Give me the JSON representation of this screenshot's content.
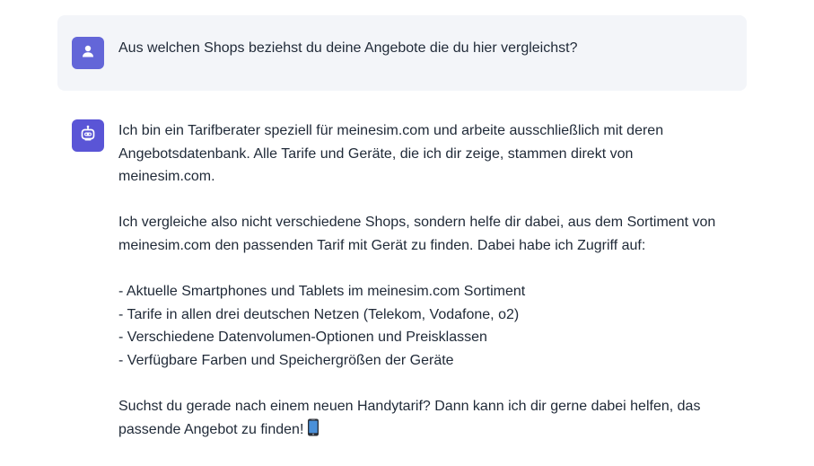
{
  "user_message": {
    "avatar_icon": "user-icon",
    "text": "Aus welchen Shops beziehst du deine Angebote die du hier vergleichst?"
  },
  "bot_message": {
    "avatar_icon": "robot-icon",
    "paragraphs": [
      [
        "Ich bin ein Tarifberater speziell für meinesim.com und arbeite ausschließlich mit deren",
        "Angebotsdatenbank. Alle Tarife und Geräte, die ich dir zeige, stammen direkt von",
        "meinesim.com."
      ],
      [
        "Ich vergleiche also nicht verschiedene Shops, sondern helfe dir dabei, aus dem Sortiment von",
        "meinesim.com den passenden Tarif mit Gerät zu finden. Dabei habe ich Zugriff auf:"
      ],
      [
        "- Aktuelle Smartphones und Tablets im meinesim.com Sortiment",
        "- Tarife in allen drei deutschen Netzen (Telekom, Vodafone, o2)",
        "- Verschiedene Datenvolumen-Optionen und Preisklassen",
        "- Verfügbare Farben und Speichergrößen der Geräte"
      ],
      [
        "Suchst du gerade nach einem neuen Handytarif? Dann kann ich dir gerne dabei helfen, das",
        "passende Angebot zu finden!"
      ]
    ],
    "trailing_icon": "mobile-phone-icon"
  },
  "colors": {
    "avatar_bg": "#6366d8",
    "user_bubble_bg": "#f3f5f9",
    "text": "#1f2937"
  }
}
